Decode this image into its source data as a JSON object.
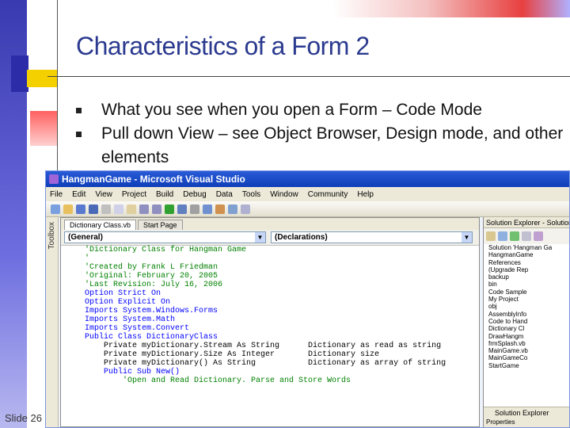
{
  "slide": {
    "title": "Characteristics of a Form 2",
    "bullets": [
      "What you see when you open a Form – Code Mode",
      "Pull down View – see Object Browser, Design mode, and other elements"
    ],
    "slide_number": "Slide 26"
  },
  "vs": {
    "window_title": "HangmanGame - Microsoft Visual Studio",
    "menu": [
      "File",
      "Edit",
      "View",
      "Project",
      "Build",
      "Debug",
      "Data",
      "Tools",
      "Window",
      "Community",
      "Help"
    ],
    "toolbox_label": "Toolbox",
    "tabs": [
      "Dictionary Class.vb",
      "Start Page"
    ],
    "dropdown_left": "(General)",
    "dropdown_right": "(Declarations)",
    "code_lines": [
      "'Dictionary Class for Hangman Game",
      "'",
      "'Created by Frank L Friedman",
      "'Original: February 20, 2005",
      "'Last Revision: July 16, 2006",
      "",
      "Option Strict On",
      "Option Explicit On",
      "",
      "Imports System.Windows.Forms",
      "Imports System.Math",
      "Imports System.Convert",
      "",
      "Public Class DictionaryClass",
      "    Private myDictionary.Stream As String      Dictionary as read as string",
      "    Private myDictionary.Size As Integer       Dictionary size",
      "    Private myDictionary() As String           Dictionary as array of string",
      "",
      "    Public Sub New()",
      "        'Open and Read Dictionary. Parse and Store Words"
    ],
    "solution_explorer": {
      "title": "Solution Explorer - Solution",
      "items": [
        "Solution 'Hangman Ga",
        "HangmanGame",
        "References",
        "(Upgrade Rep",
        "backup",
        "bin",
        "Code Sample",
        "My Project",
        "obj",
        "AssemblyInfo",
        "Code to Hand",
        "Dictionary Cl",
        "DrawHangm",
        "frmSplash.vb",
        "MainGame.vb",
        "MainGameCo",
        "StartGame"
      ],
      "tab_label": "Solution Explorer",
      "properties_label": "Properties"
    }
  }
}
